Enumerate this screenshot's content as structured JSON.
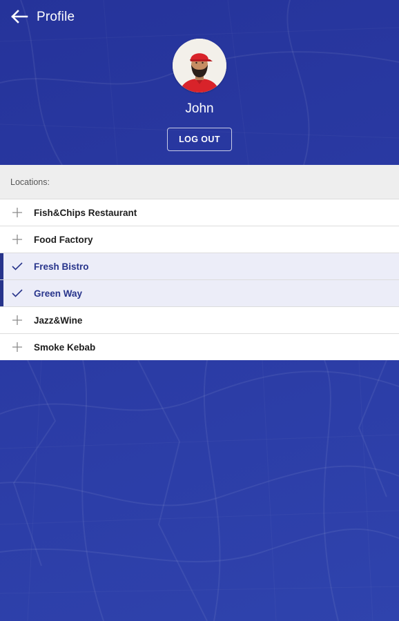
{
  "header": {
    "title": "Profile",
    "back_icon": "arrow-left-icon"
  },
  "profile": {
    "name": "John",
    "logout_label": "LOG OUT"
  },
  "locations": {
    "header": "Locations:",
    "items": [
      {
        "label": "Fish&Chips Restaurant",
        "selected": false,
        "icon": "plus-icon"
      },
      {
        "label": "Food Factory",
        "selected": false,
        "icon": "plus-icon"
      },
      {
        "label": "Fresh Bistro",
        "selected": true,
        "icon": "check-icon"
      },
      {
        "label": "Green Way",
        "selected": true,
        "icon": "check-icon"
      },
      {
        "label": "Jazz&Wine",
        "selected": false,
        "icon": "plus-icon"
      },
      {
        "label": "Smoke Kebab",
        "selected": false,
        "icon": "plus-icon"
      }
    ]
  },
  "colors": {
    "primary": "#27348b",
    "background": "#2c3c9e",
    "selected_row": "#ecedf8"
  }
}
